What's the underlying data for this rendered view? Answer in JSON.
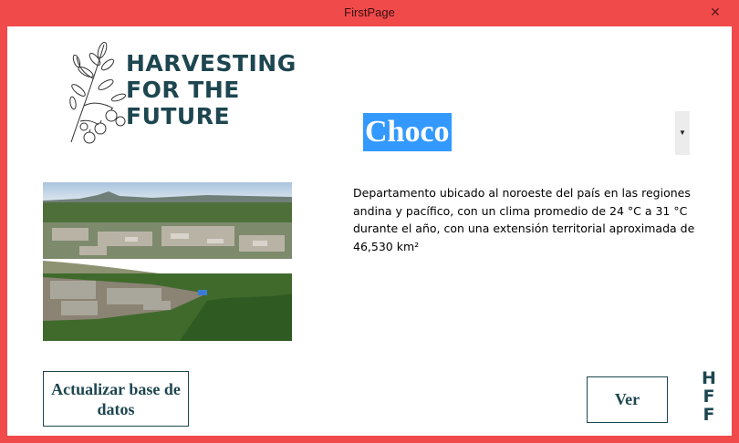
{
  "window": {
    "title": "FirstPage",
    "close_label": "✕"
  },
  "logo": {
    "line1": "HARVESTING",
    "line2": "FOR THE",
    "line3": "FUTURE"
  },
  "region_select": {
    "selected": "Choco"
  },
  "description": "Departamento ubicado al noroeste del país en las regiones andina y pacífico, con un clima promedio de 24 °C a 31 °C durante el año, con una extensión territorial aproximada de 46,530 km²",
  "buttons": {
    "update_label": "Actualizar base de datos",
    "view_label": "Ver"
  },
  "corner_logo": {
    "l1": "H",
    "l2": "F",
    "l3": "F"
  }
}
